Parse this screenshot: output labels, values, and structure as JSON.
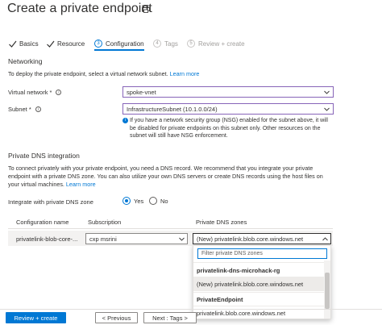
{
  "page": {
    "title": "Create a private endpoint"
  },
  "tabs": [
    {
      "label": "Basics",
      "state": "done"
    },
    {
      "label": "Resource",
      "state": "done"
    },
    {
      "number": "3",
      "label": "Configuration",
      "state": "active"
    },
    {
      "number": "4",
      "label": "Tags",
      "state": "disabled"
    },
    {
      "number": "5",
      "label": "Review + create",
      "state": "disabled"
    }
  ],
  "networking": {
    "heading": "Networking",
    "description": "To deploy the private endpoint, select a virtual network subnet.",
    "learn_more": "Learn more",
    "vnet_label": "Virtual network *",
    "vnet_value": "spoke-vnet",
    "subnet_label": "Subnet *",
    "subnet_value": "InfrastructureSubnet (10.1.0.0/24)",
    "nsg_info_line1": "If you have a network security group (NSG) enabled for the subnet above, it will",
    "nsg_info_line2": "be disabled for private endpoints on this subnet only. Other resources on the",
    "nsg_info_line3": "subnet will still have NSG enforcement."
  },
  "dns": {
    "heading": "Private DNS integration",
    "desc_line1": "To connect privately with your private endpoint, you need a DNS record. We recommend that you integrate your private",
    "desc_line2": "endpoint with a private DNS zone. You can also utilize your own DNS servers or create DNS records using the host files on",
    "desc_line3": "your virtual machines.",
    "learn_more": "Learn more",
    "integrate_label": "Integrate with private DNS zone",
    "yes_label": "Yes",
    "no_label": "No",
    "integrate_selected": "Yes"
  },
  "grid": {
    "headers": [
      "Configuration name",
      "Subscription",
      "Private DNS zones"
    ],
    "row": {
      "config_name": "privatelink-blob-core-...",
      "subscription": "cxp msrini",
      "dns_zone": "(New) privatelink.blob.core.windows.net"
    }
  },
  "dropdown": {
    "filter_placeholder": "Filter private DNS zones",
    "group1": "privatelink-dns-microhack-rg",
    "item1": "(New) privatelink.blob.core.windows.net",
    "group2": "PrivateEndpoint",
    "item2": "privatelink.blob.core.windows.net"
  },
  "footer": {
    "review_create": "Review + create",
    "previous": "< Previous",
    "next": "Next : Tags >"
  },
  "colors": {
    "accent": "#0078d4",
    "focus_border": "#8764b8"
  }
}
